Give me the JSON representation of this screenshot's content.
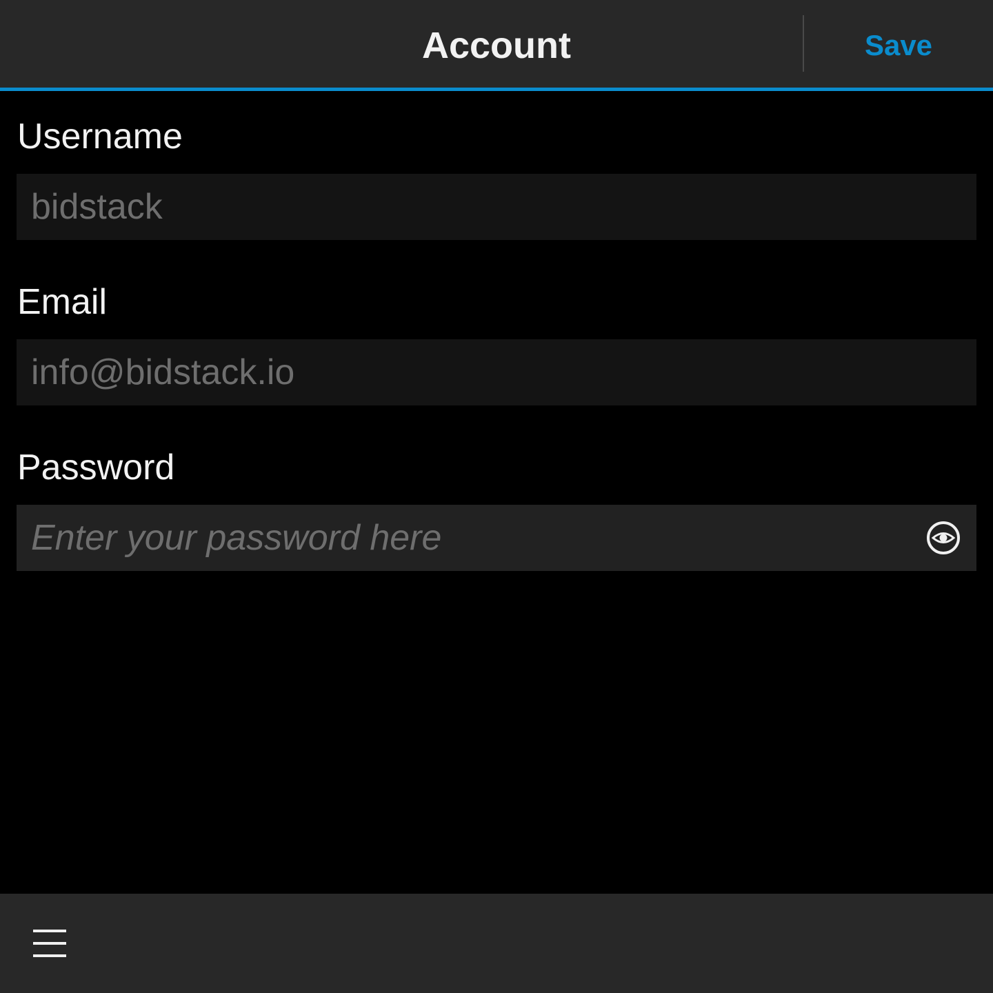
{
  "header": {
    "title": "Account",
    "save_label": "Save",
    "accent_color": "#0a8ccd"
  },
  "form": {
    "username": {
      "label": "Username",
      "value": "bidstack"
    },
    "email": {
      "label": "Email",
      "value": "info@bidstack.io"
    },
    "password": {
      "label": "Password",
      "value": "",
      "placeholder": "Enter your password here",
      "toggle_icon": "eye-icon"
    }
  },
  "actionbar": {
    "menu_icon": "hamburger-menu-icon"
  }
}
